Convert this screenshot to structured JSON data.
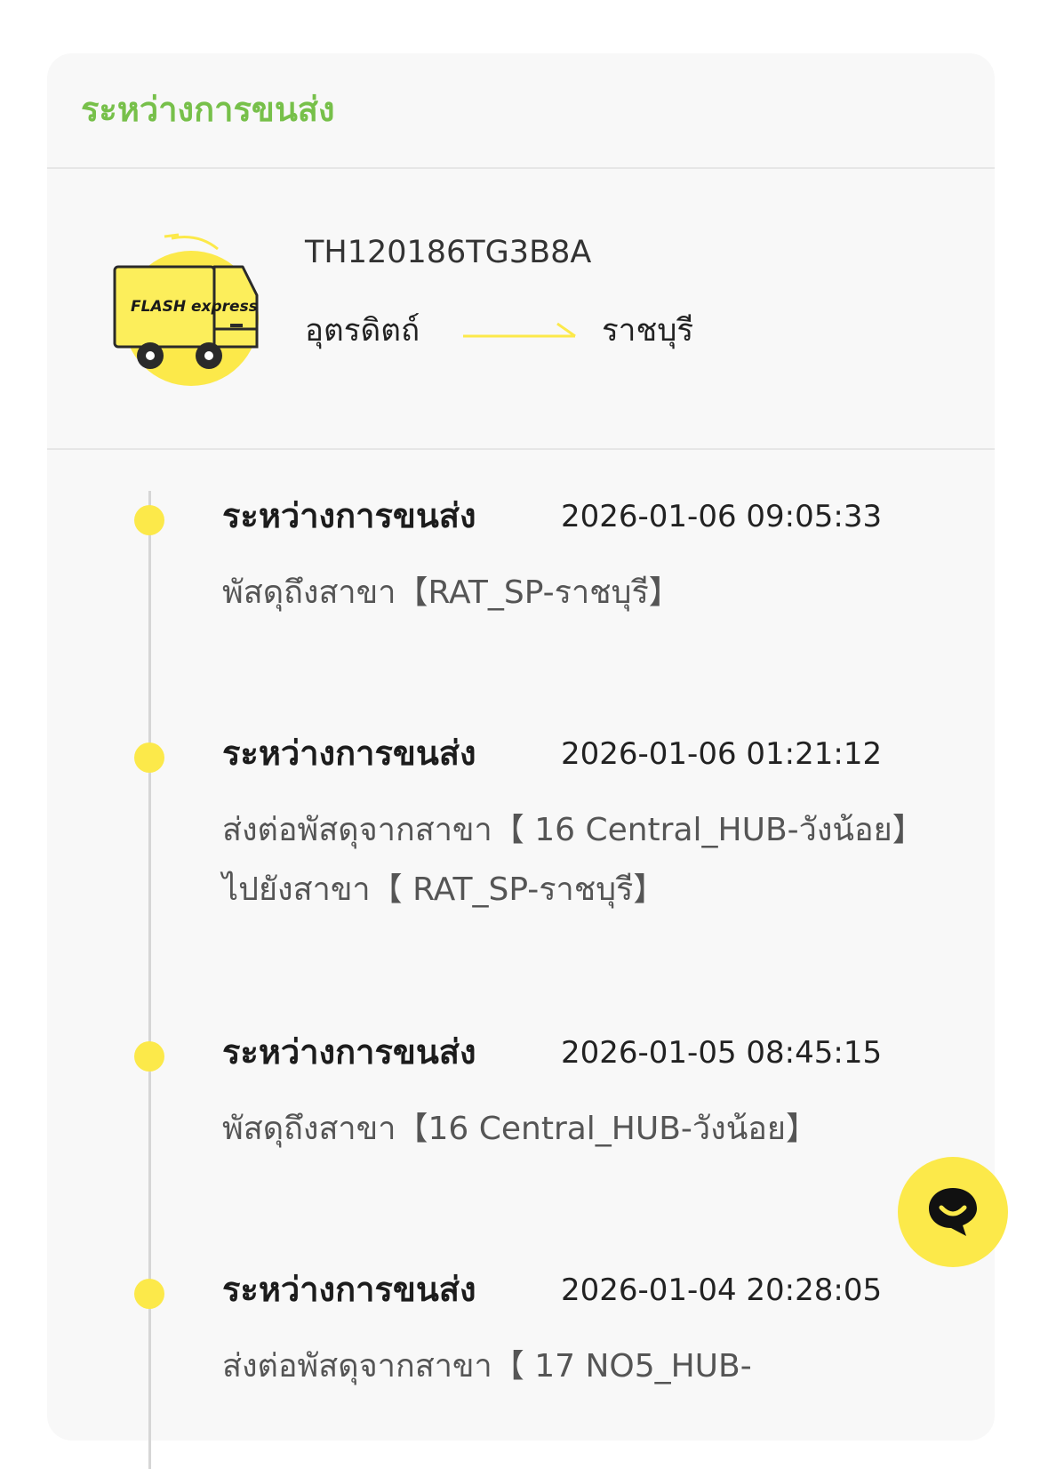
{
  "card": {
    "status_title": "ระหว่างการขนส่ง"
  },
  "shipment": {
    "tracking_number": "TH120186TG3B8A",
    "origin": "อุตรดิตถ์",
    "destination": "ราชบุรี",
    "brand_logo_text": "FLASH express"
  },
  "events": [
    {
      "status": "ระหว่างการขนส่ง",
      "datetime": "2026-01-06  09:05:33",
      "description": "พัสดุถึงสาขา【RAT_SP-ราชบุรี】"
    },
    {
      "status": "ระหว่างการขนส่ง",
      "datetime": "2026-01-06  01:21:12",
      "description": "ส่งต่อพัสดุจากสาขา【 16 Central_HUB-วังน้อย】 ไปยังสาขา【 RAT_SP-ราชบุรี】"
    },
    {
      "status": "ระหว่างการขนส่ง",
      "datetime": "2026-01-05  08:45:15",
      "description": "พัสดุถึงสาขา【16 Central_HUB-วังน้อย】"
    },
    {
      "status": "ระหว่างการขนส่ง",
      "datetime": "2026-01-04  20:28:05",
      "description": "ส่งต่อพัสดุจากสาขา【 17 NO5_HUB-"
    }
  ],
  "colors": {
    "accent_green": "#77c04a",
    "brand_yellow": "#fce94a",
    "card_bg": "#f8f8f8"
  },
  "icons": {
    "truck": "delivery-truck-icon",
    "arrow": "route-arrow-icon",
    "chat": "chat-bubble-icon"
  }
}
